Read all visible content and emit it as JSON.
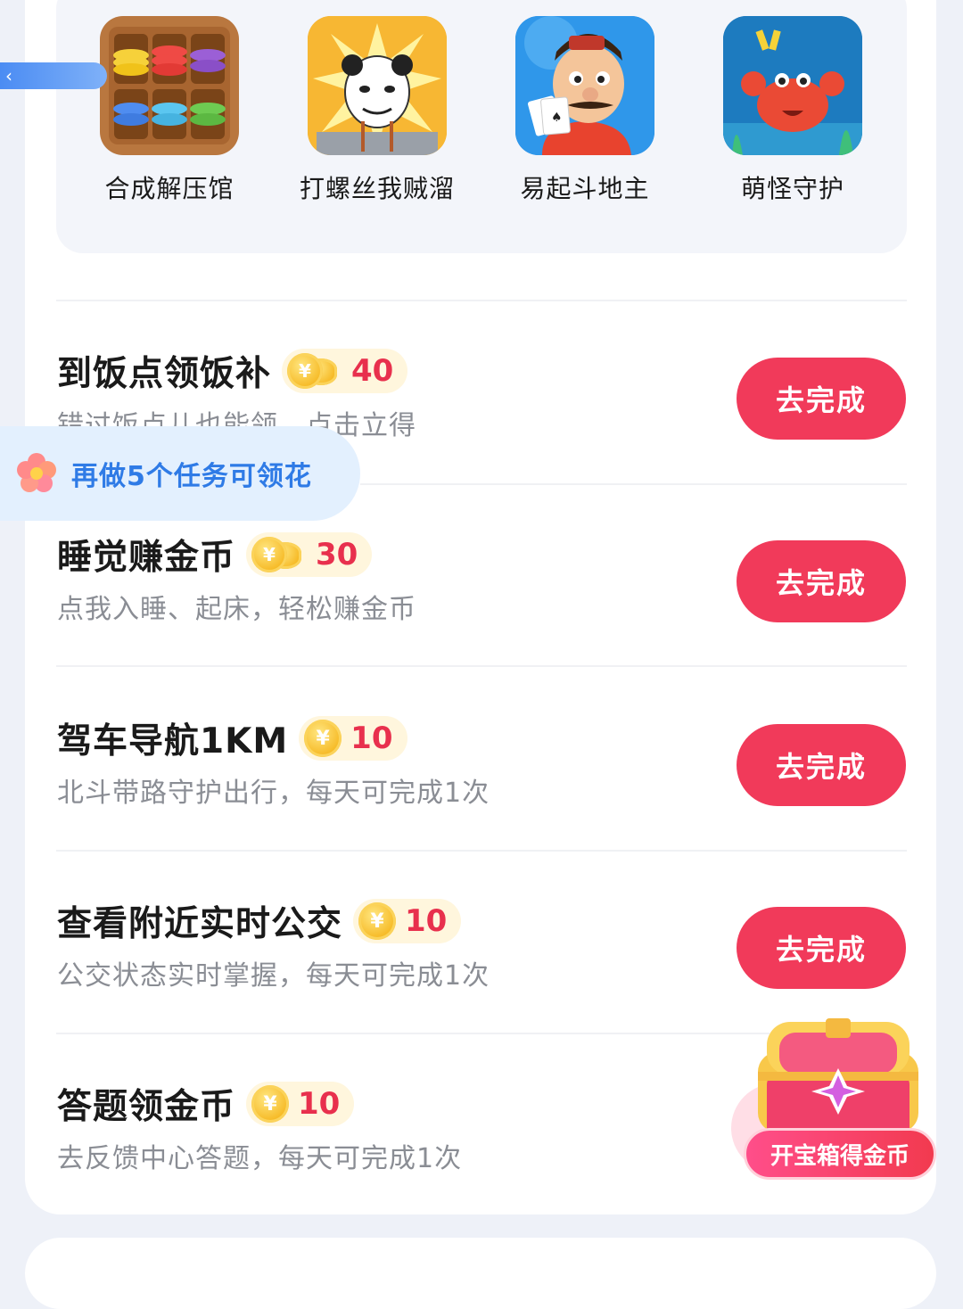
{
  "games": [
    {
      "name": "合成解压馆",
      "icon": "stacking-discs-game-icon"
    },
    {
      "name": "打螺丝我贼溜",
      "icon": "panda-meme-game-icon"
    },
    {
      "name": "易起斗地主",
      "icon": "card-player-game-icon"
    },
    {
      "name": "萌怪守护",
      "icon": "crab-game-icon"
    }
  ],
  "tasks": [
    {
      "title": "到饭点领饭补",
      "reward": "40",
      "subtitle": "错过饭点儿也能领，点击立得",
      "button": "去完成",
      "coin": "stack"
    },
    {
      "title": "睡觉赚金币",
      "reward": "30",
      "subtitle": "点我入睡、起床，轻松赚金币",
      "button": "去完成",
      "coin": "stack"
    },
    {
      "title": "驾车导航1KM",
      "reward": "10",
      "subtitle": "北斗带路守护出行，每天可完成1次",
      "button": "去完成",
      "coin": "single"
    },
    {
      "title": "查看附近实时公交",
      "reward": "10",
      "subtitle": "公交状态实时掌握，每天可完成1次",
      "button": "去完成",
      "coin": "single"
    },
    {
      "title": "答题领金币",
      "reward": "10",
      "subtitle": "去反馈中心答题，每天可完成1次",
      "button": null,
      "coin": "single"
    }
  ],
  "coin_symbol": "¥",
  "flower_banner": {
    "text": "再做5个任务可领花"
  },
  "back_tab": {
    "icon": "chevron-left-icon",
    "glyph": "‹"
  },
  "chest": {
    "label": "开宝箱得金币",
    "icon": "treasure-chest-icon"
  },
  "colors": {
    "accent": "#f13a5a",
    "reward_text": "#e8304d",
    "banner_text": "#2f7be6"
  }
}
